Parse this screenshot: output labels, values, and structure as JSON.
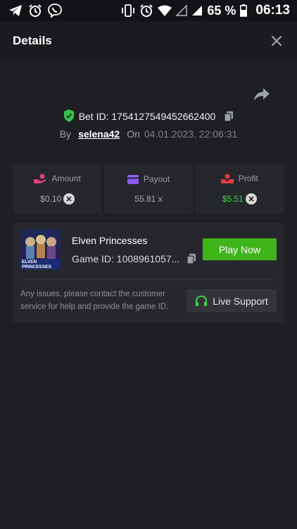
{
  "status_bar": {
    "battery_percent": "65 %",
    "time": "06:13",
    "left_icons": [
      "telegram-icon",
      "alarm-icon",
      "viber-icon"
    ],
    "right_icons": [
      "vibrate-icon",
      "alarm-icon",
      "wifi-icon",
      "signal-empty-icon",
      "signal-icon",
      "battery-icon"
    ]
  },
  "header": {
    "title": "Details",
    "close_icon": "close-icon"
  },
  "bet": {
    "id_label": "Bet ID: 1754127549452662400",
    "by_label": "By",
    "username": "selena42",
    "on_label": "On",
    "date": "04.01.2023, 22:06:31"
  },
  "stats": {
    "amount": {
      "label": "Amount",
      "value": "$0.10",
      "icon": "hand-coins-icon",
      "color": "#e0407a"
    },
    "payout": {
      "label": "Payout",
      "value": "55.81 x",
      "icon": "wallet-icon",
      "color": "#8b5cf6"
    },
    "profit": {
      "label": "Profit",
      "value": "$5.51",
      "icon": "hand-money-icon",
      "color": "#e23b3b"
    }
  },
  "game": {
    "name": "Elven Princesses",
    "id_label": "Game ID: 1008961057...",
    "play_label": "Play Now",
    "thumb_title": "ELVEN PRINCESSES",
    "help_text": "Any issues, please contact the customer service for help and provide the game ID.",
    "support_label": "Live Support"
  },
  "colors": {
    "background": "#1e1f23",
    "card": "#26272c",
    "accent_green": "#3fb51a",
    "profit_green": "#3fd34a"
  }
}
